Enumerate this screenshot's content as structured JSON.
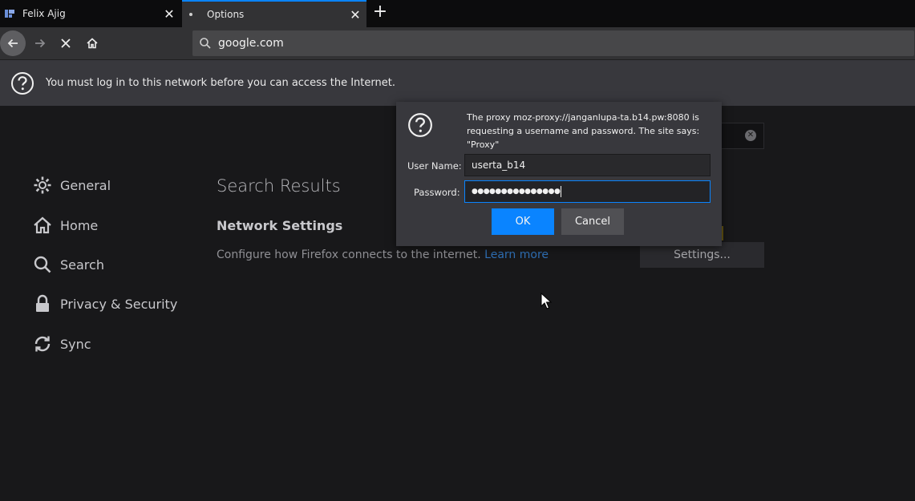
{
  "tabs": [
    {
      "title": "Felix Ajig",
      "close": "✕"
    },
    {
      "title": "Options",
      "close": "✕"
    }
  ],
  "new_tab": "+",
  "urlbar": {
    "value": "google.com"
  },
  "notification": {
    "text": "You must log in to this network before you can access the Internet."
  },
  "sidebar": {
    "items": [
      {
        "label": "General",
        "icon": "gear-icon"
      },
      {
        "label": "Home",
        "icon": "home-icon"
      },
      {
        "label": "Search",
        "icon": "search-icon"
      },
      {
        "label": "Privacy & Security",
        "icon": "lock-icon"
      },
      {
        "label": "Sync",
        "icon": "sync-icon"
      }
    ]
  },
  "main": {
    "heading": "Search Results",
    "section_title": "Network Settings",
    "description": "Configure how Firefox connects to the internet.",
    "learn_more": "Learn more",
    "settings_button": "Settings..."
  },
  "dialog": {
    "message": "The proxy moz-proxy://janganlupa-ta.b14.pw:8080 is requesting a username and password. The site says: \"Proxy\"",
    "username_label": "User Name:",
    "username_value": "userta_b14",
    "password_label": "Password:",
    "password_value": "●●●●●●●●●●●●●●●",
    "ok_label": "OK",
    "cancel_label": "Cancel"
  },
  "colors": {
    "accent": "#0a84ff",
    "background": "#18181a",
    "toolbar": "#323234",
    "link": "#2f6fb4"
  }
}
